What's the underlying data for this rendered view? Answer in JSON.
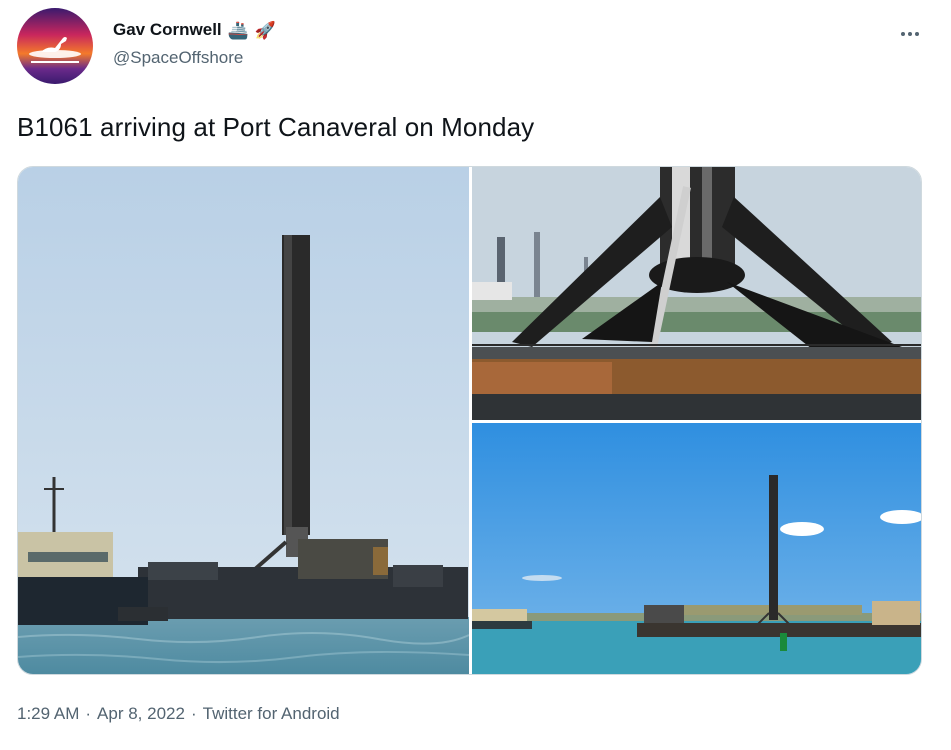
{
  "author": {
    "display_name": "Gav Cornwell",
    "badges": [
      "🚢",
      "🚀"
    ],
    "handle": "@SpaceOffshore",
    "avatar_icon": "seagull-sunset-icon"
  },
  "tweet": {
    "text": "B1061 arriving at Port Canaveral on Monday"
  },
  "media": {
    "photos": [
      {
        "name": "photo-booster-on-drone-ship-wide"
      },
      {
        "name": "photo-booster-landing-legs-closeup"
      },
      {
        "name": "photo-booster-harbor-arrival"
      }
    ]
  },
  "footer": {
    "time": "1:29 AM",
    "separator": "·",
    "date": "Apr 8, 2022",
    "source": "Twitter for Android"
  },
  "colors": {
    "text_primary": "#0f1419",
    "text_secondary": "#536471",
    "border": "#cfd9de"
  }
}
